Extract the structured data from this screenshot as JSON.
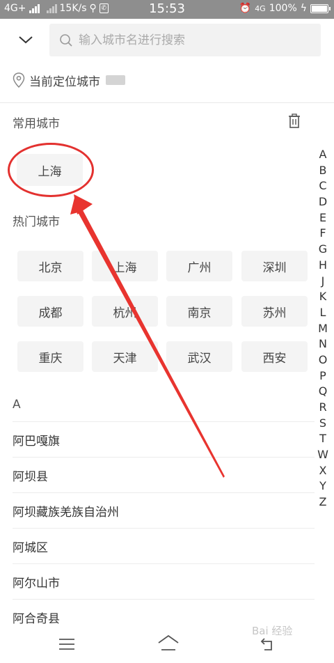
{
  "status_bar": {
    "network": "4G+",
    "speed": "15K/s",
    "time": "15:53",
    "right_network": "4G",
    "battery": "100%"
  },
  "search": {
    "placeholder": "输入城市名进行搜索"
  },
  "location": {
    "label": "当前定位城市"
  },
  "frequent": {
    "title": "常用城市",
    "cities": [
      "上海"
    ]
  },
  "hot": {
    "title": "热门城市",
    "cities": [
      "北京",
      "上海",
      "广州",
      "深圳",
      "成都",
      "杭州",
      "南京",
      "苏州",
      "重庆",
      "天津",
      "武汉",
      "西安"
    ]
  },
  "index_letters": [
    "A",
    "B",
    "C",
    "D",
    "E",
    "F",
    "G",
    "H",
    "J",
    "K",
    "L",
    "M",
    "N",
    "O",
    "P",
    "Q",
    "R",
    "S",
    "T",
    "W",
    "X",
    "Y",
    "Z"
  ],
  "list": {
    "group_letter": "A",
    "cities": [
      "阿巴嘎旗",
      "阿坝县",
      "阿坝藏族羌族自治州",
      "阿城区",
      "阿尔山市",
      "阿合奇县"
    ]
  },
  "annotation": {
    "color": "#e3312f"
  },
  "watermark": "Bai 经验"
}
